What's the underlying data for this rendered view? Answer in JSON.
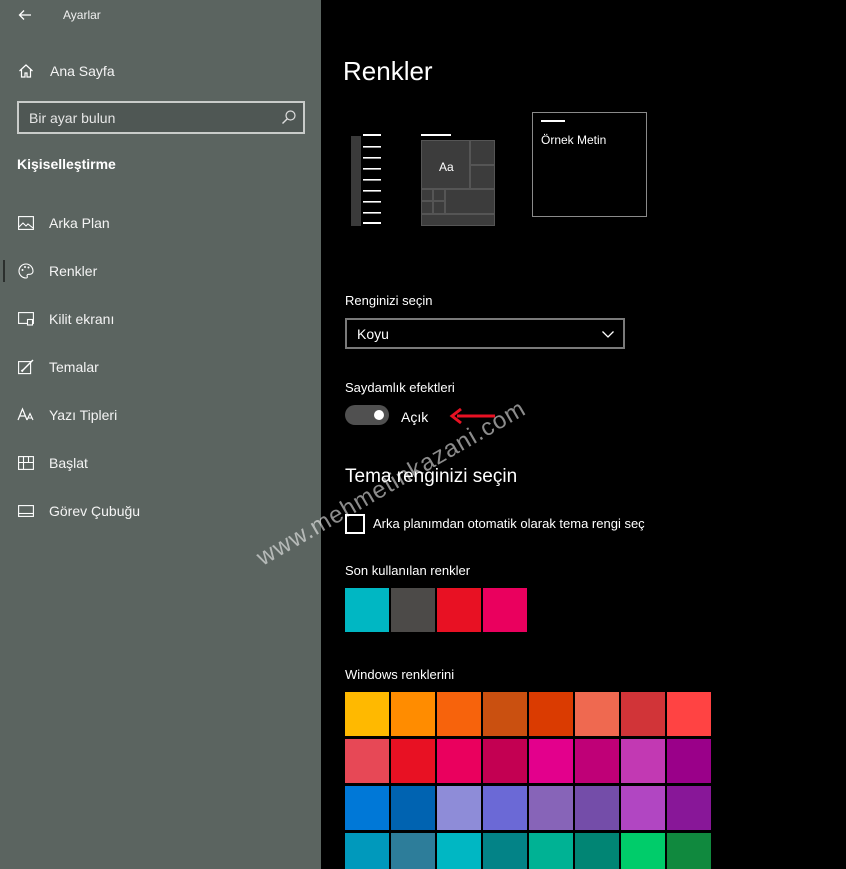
{
  "app_title": "Ayarlar",
  "sidebar": {
    "home_label": "Ana Sayfa",
    "search_placeholder": "Bir ayar bulun",
    "section": "Kişiselleştirme",
    "items": [
      {
        "label": "Arka Plan",
        "icon": "picture-icon"
      },
      {
        "label": "Renkler",
        "icon": "palette-icon"
      },
      {
        "label": "Kilit ekranı",
        "icon": "lock-screen-icon"
      },
      {
        "label": "Temalar",
        "icon": "theme-brush-icon"
      },
      {
        "label": "Yazı Tipleri",
        "icon": "font-icon"
      },
      {
        "label": "Başlat",
        "icon": "start-tiles-icon"
      },
      {
        "label": "Görev Çubuğu",
        "icon": "taskbar-icon"
      }
    ]
  },
  "main": {
    "title": "Renkler",
    "preview": {
      "tile_text": "Aa",
      "sample_text": "Örnek Metin"
    },
    "color_mode_label": "Renginizi seçin",
    "color_mode_value": "Koyu",
    "transparency_label": "Saydamlık efektleri",
    "transparency_state": "Açık",
    "accent_heading": "Tema renginizi seçin",
    "auto_accent_label": "Arka planımdan otomatik olarak tema rengi seç",
    "recent_label": "Son kullanılan renkler",
    "recent_colors": [
      "#00b7c3",
      "#4c4a48",
      "#e81123",
      "#ea005e"
    ],
    "windows_label": "Windows renklerini",
    "windows_colors": [
      [
        "#ffb900",
        "#ff8c00",
        "#f7630c",
        "#ca5010",
        "#da3b01",
        "#ef6950",
        "#d13438",
        "#ff4343"
      ],
      [
        "#e74856",
        "#e81123",
        "#ea005e",
        "#c30052",
        "#e3008c",
        "#bf0077",
        "#c239b3",
        "#9a0089"
      ],
      [
        "#0078d7",
        "#0063b1",
        "#8e8cd8",
        "#6b69d6",
        "#8764b8",
        "#744da9",
        "#b146c2",
        "#881798"
      ],
      [
        "#0099bc",
        "#2d7d9a",
        "#00b7c3",
        "#038387",
        "#00b294",
        "#018574",
        "#00cc6a",
        "#10893e"
      ]
    ]
  },
  "watermark": "www.mehmetinkazani.com",
  "colors": {
    "sidebar_bg": "#5b6460",
    "main_bg": "#000000",
    "arrow": "#e81123"
  }
}
